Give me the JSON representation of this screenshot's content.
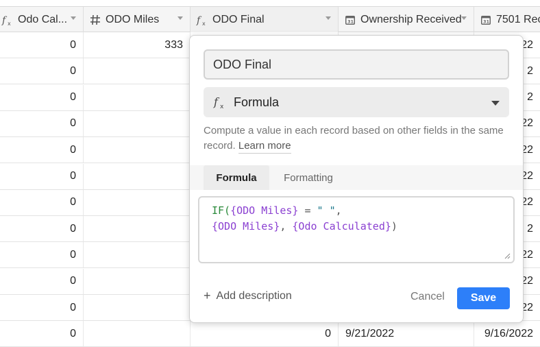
{
  "columns": [
    {
      "label": "Odo Cal...",
      "icon": "formula-icon"
    },
    {
      "label": "ODO Miles",
      "icon": "number-icon"
    },
    {
      "label": "ODO Final",
      "icon": "formula-icon"
    },
    {
      "label": "Ownership Received",
      "icon": "calendar-icon"
    },
    {
      "label": "7501 Rec",
      "icon": "calendar-icon"
    }
  ],
  "rows": [
    {
      "odo_cal": "0",
      "odo_miles": "333",
      "odo_final": "",
      "ownership": "",
      "rec7501": "22"
    },
    {
      "odo_cal": "0",
      "odo_miles": "",
      "odo_final": "",
      "ownership": "",
      "rec7501": "2"
    },
    {
      "odo_cal": "0",
      "odo_miles": "",
      "odo_final": "",
      "ownership": "",
      "rec7501": "2"
    },
    {
      "odo_cal": "0",
      "odo_miles": "",
      "odo_final": "",
      "ownership": "",
      "rec7501": "22"
    },
    {
      "odo_cal": "0",
      "odo_miles": "",
      "odo_final": "",
      "ownership": "",
      "rec7501": "22"
    },
    {
      "odo_cal": "0",
      "odo_miles": "",
      "odo_final": "",
      "ownership": "",
      "rec7501": "22"
    },
    {
      "odo_cal": "0",
      "odo_miles": "",
      "odo_final": "",
      "ownership": "",
      "rec7501": "22"
    },
    {
      "odo_cal": "0",
      "odo_miles": "",
      "odo_final": "",
      "ownership": "",
      "rec7501": "2"
    },
    {
      "odo_cal": "0",
      "odo_miles": "",
      "odo_final": "",
      "ownership": "",
      "rec7501": "22"
    },
    {
      "odo_cal": "0",
      "odo_miles": "",
      "odo_final": "",
      "ownership": "",
      "rec7501": "22"
    },
    {
      "odo_cal": "0",
      "odo_miles": "",
      "odo_final": "",
      "ownership": "",
      "rec7501": "22"
    },
    {
      "odo_cal": "0",
      "odo_miles": "",
      "odo_final": "0",
      "ownership": "9/21/2022",
      "rec7501": "9/16/2022"
    }
  ],
  "popup": {
    "field_name": "ODO Final",
    "field_type": "Formula",
    "description": "Compute a value in each record based on other fields in the same record.",
    "learn_more": "Learn more",
    "tabs": [
      "Formula",
      "Formatting"
    ],
    "formula": {
      "fn": "IF(",
      "field1": "{ODO Miles}",
      "op": " = ",
      "str": "\" \"",
      "comma1": ",",
      "field2": "{ODO Miles}",
      "comma2": ", ",
      "field3": "{Odo Calculated}",
      "close": ")"
    },
    "add_description": "Add description",
    "cancel": "Cancel",
    "save": "Save"
  },
  "colors": {
    "accent": "#2d7ff9",
    "formula_fn": "#2a8a3a",
    "formula_field": "#8a3fd1",
    "formula_string": "#1f7a8c"
  }
}
